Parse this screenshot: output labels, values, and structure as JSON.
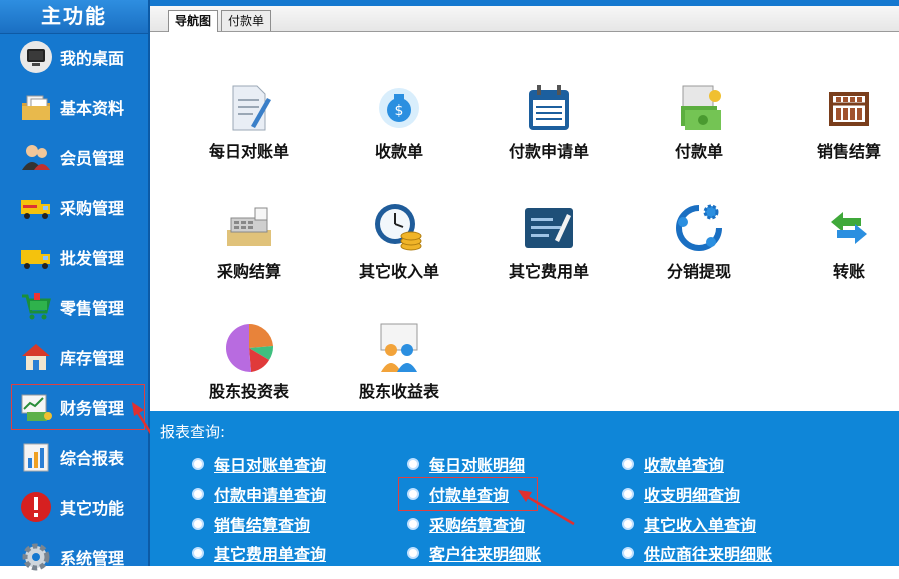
{
  "sidebar": {
    "title": "主功能",
    "items": [
      {
        "label": "我的桌面",
        "icon": "monitor-icon"
      },
      {
        "label": "基本资料",
        "icon": "folder-docs-icon"
      },
      {
        "label": "会员管理",
        "icon": "users-icon"
      },
      {
        "label": "采购管理",
        "icon": "delivery-truck-icon"
      },
      {
        "label": "批发管理",
        "icon": "truck-icon"
      },
      {
        "label": "零售管理",
        "icon": "shopping-cart-icon"
      },
      {
        "label": "库存管理",
        "icon": "house-icon"
      },
      {
        "label": "财务管理",
        "icon": "money-chart-icon"
      },
      {
        "label": "综合报表",
        "icon": "bar-chart-icon"
      },
      {
        "label": "其它功能",
        "icon": "alert-icon"
      },
      {
        "label": "系统管理",
        "icon": "gear-icon"
      }
    ]
  },
  "tabs": [
    {
      "label": "导航图"
    },
    {
      "label": "付款单"
    }
  ],
  "tiles": [
    {
      "label": "每日对账单",
      "icon": "document-pen-icon"
    },
    {
      "label": "收款单",
      "icon": "money-bag-icon"
    },
    {
      "label": "付款申请单",
      "icon": "calendar-icon"
    },
    {
      "label": "付款单",
      "icon": "cash-notes-icon"
    },
    {
      "label": "销售结算",
      "icon": "abacus-icon"
    },
    {
      "label": "采购结算",
      "icon": "cash-register-icon"
    },
    {
      "label": "其它收入单",
      "icon": "clock-coins-icon"
    },
    {
      "label": "其它费用单",
      "icon": "card-pen-icon"
    },
    {
      "label": "分销提现",
      "icon": "gears-icon"
    },
    {
      "label": "转账",
      "icon": "transfer-arrows-icon"
    },
    {
      "label": "股东投资表",
      "icon": "pie-chart-icon"
    },
    {
      "label": "股东收益表",
      "icon": "people-presentation-icon"
    }
  ],
  "reports": {
    "title": "报表查询:",
    "links": [
      {
        "label": "每日对账单查询"
      },
      {
        "label": "每日对账明细"
      },
      {
        "label": "收款单查询"
      },
      {
        "label": "付款申请单查询"
      },
      {
        "label": "付款单查询"
      },
      {
        "label": "收支明细查询"
      },
      {
        "label": "销售结算查询"
      },
      {
        "label": "采购结算查询"
      },
      {
        "label": "其它收入单查询"
      },
      {
        "label": "其它费用单查询"
      },
      {
        "label": "客户往来明细账"
      },
      {
        "label": "供应商往来明细账"
      }
    ]
  },
  "colors": {
    "accent": "#1578cf",
    "panel": "#0f86d8",
    "highlight": "#e04040"
  }
}
